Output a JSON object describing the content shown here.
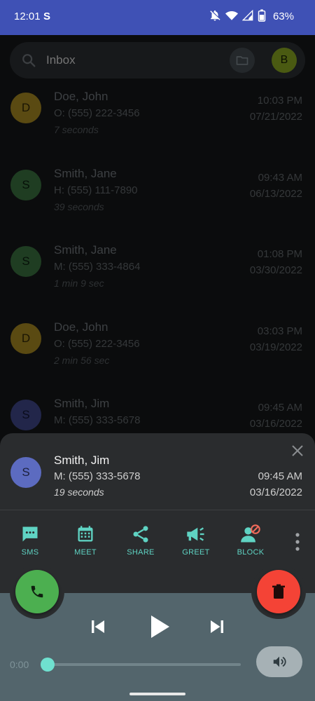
{
  "status_bar": {
    "time": "12:01",
    "s_icon": "S",
    "battery_pct": "63%",
    "icons": [
      "notifications-off-icon",
      "wifi-icon",
      "signal-icon",
      "battery-icon"
    ]
  },
  "search": {
    "placeholder": "Inbox",
    "profile_initial": "B"
  },
  "calls": [
    {
      "initial": "D",
      "name": "Doe, John",
      "number": "O: (555) 222-3456",
      "duration": "7 seconds",
      "time": "10:03 PM",
      "date": "07/21/2022",
      "avatar_color": "#5a4a12",
      "initial_color": "#1a1503"
    },
    {
      "initial": "S",
      "name": "Smith, Jane",
      "number": "H: (555) 111-7890",
      "duration": "39 seconds",
      "time": "09:43 AM",
      "date": "06/13/2022",
      "avatar_color": "#1f3d22",
      "initial_color": "#061008"
    },
    {
      "initial": "S",
      "name": "Smith, Jane",
      "number": "M: (555) 333-4864",
      "duration": "1 min 9 sec",
      "time": "01:08 PM",
      "date": "03/30/2022",
      "avatar_color": "#1f3d22",
      "initial_color": "#061008"
    },
    {
      "initial": "D",
      "name": "Doe, John",
      "number": "O: (555) 222-3456",
      "duration": "2 min 56 sec",
      "time": "03:03 PM",
      "date": "03/19/2022",
      "avatar_color": "#5a4a12",
      "initial_color": "#1a1503"
    },
    {
      "initial": "S",
      "name": "Smith, Jim",
      "number": "M: (555) 333-5678",
      "duration": "",
      "time": "09:45 AM",
      "date": "03/16/2022",
      "avatar_color": "#22264a",
      "initial_color": "#0a0c1c"
    }
  ],
  "sheet": {
    "initial": "S",
    "name": "Smith, Jim",
    "number": "M: (555) 333-5678",
    "duration": "19 seconds",
    "time": "09:45 AM",
    "date": "03/16/2022"
  },
  "actions": [
    {
      "label": "SMS",
      "icon": "sms-icon"
    },
    {
      "label": "MEET",
      "icon": "calendar-icon"
    },
    {
      "label": "SHARE",
      "icon": "share-icon"
    },
    {
      "label": "GREET",
      "icon": "megaphone-icon"
    },
    {
      "label": "BLOCK",
      "icon": "block-user-icon"
    }
  ],
  "player": {
    "elapsed": "0:00",
    "progress": 0
  },
  "colors": {
    "accent": "#5fd3c3",
    "call_fab": "#4caf50",
    "delete_fab": "#f44336",
    "status_bar": "#3f51b5"
  }
}
